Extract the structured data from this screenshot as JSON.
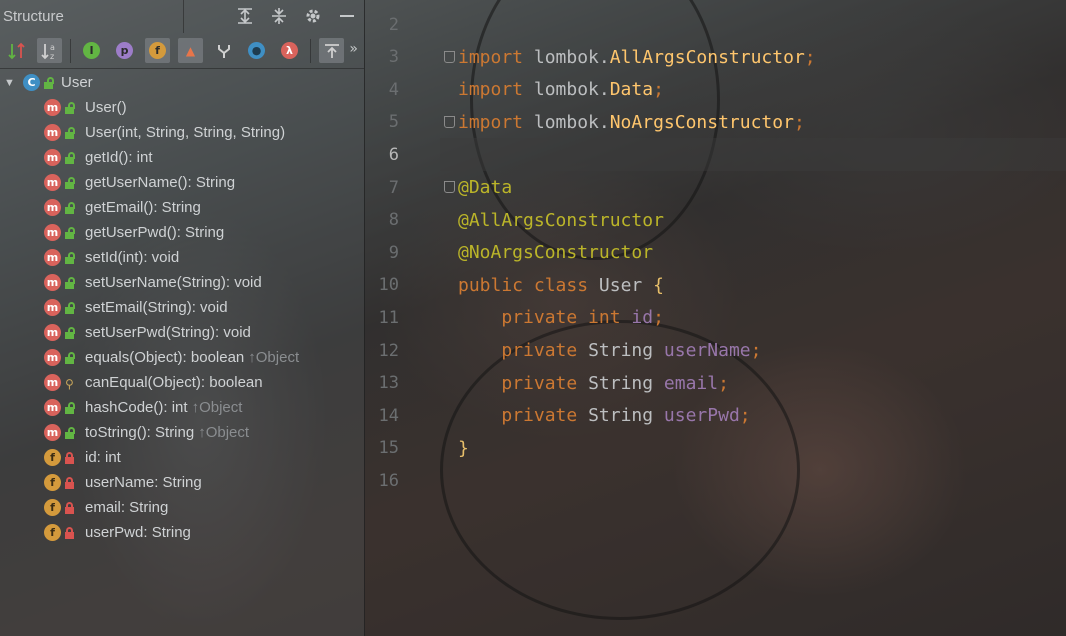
{
  "structure_panel": {
    "title": "Structure",
    "header_tools": [
      "expand-all-icon",
      "collapse-all-icon",
      "gear-icon",
      "minimize-icon"
    ],
    "toolbar": {
      "sort_by_visibility": "sort-visibility-icon",
      "sort_alpha_label": "↓a z",
      "show_inherited": "I",
      "show_properties": "p",
      "show_fields": "f",
      "show_non_public": "▲",
      "show_anonymous": "anonymous-icon",
      "show_lambdas_circle": "●",
      "show_lambdas": "λ",
      "autoscroll": "autoscroll-icon",
      "more": "»"
    },
    "root": {
      "label": "User",
      "icon": "C"
    },
    "members": [
      {
        "kind": "m",
        "visibility": "public",
        "label": "User()",
        "inherited": ""
      },
      {
        "kind": "m",
        "visibility": "public",
        "label": "User(int, String, String, String)",
        "inherited": ""
      },
      {
        "kind": "m",
        "visibility": "public",
        "label": "getId(): int",
        "inherited": ""
      },
      {
        "kind": "m",
        "visibility": "public",
        "label": "getUserName(): String",
        "inherited": ""
      },
      {
        "kind": "m",
        "visibility": "public",
        "label": "getEmail(): String",
        "inherited": ""
      },
      {
        "kind": "m",
        "visibility": "public",
        "label": "getUserPwd(): String",
        "inherited": ""
      },
      {
        "kind": "m",
        "visibility": "public",
        "label": "setId(int): void",
        "inherited": ""
      },
      {
        "kind": "m",
        "visibility": "public",
        "label": "setUserName(String): void",
        "inherited": ""
      },
      {
        "kind": "m",
        "visibility": "public",
        "label": "setEmail(String): void",
        "inherited": ""
      },
      {
        "kind": "m",
        "visibility": "public",
        "label": "setUserPwd(String): void",
        "inherited": ""
      },
      {
        "kind": "m",
        "visibility": "public",
        "label": "equals(Object): boolean",
        "inherited": "↑Object"
      },
      {
        "kind": "m",
        "visibility": "protected",
        "label": "canEqual(Object): boolean",
        "inherited": ""
      },
      {
        "kind": "m",
        "visibility": "public",
        "label": "hashCode(): int",
        "inherited": "↑Object"
      },
      {
        "kind": "m",
        "visibility": "public",
        "label": "toString(): String",
        "inherited": "↑Object"
      },
      {
        "kind": "f",
        "visibility": "private",
        "label": "id: int",
        "inherited": ""
      },
      {
        "kind": "f",
        "visibility": "private",
        "label": "userName: String",
        "inherited": ""
      },
      {
        "kind": "f",
        "visibility": "private",
        "label": "email: String",
        "inherited": ""
      },
      {
        "kind": "f",
        "visibility": "private",
        "label": "userPwd: String",
        "inherited": ""
      }
    ]
  },
  "editor": {
    "current_line": "6",
    "lines": [
      {
        "n": "2",
        "tokens": []
      },
      {
        "n": "3",
        "fold": true,
        "tokens": [
          [
            "kw",
            "import "
          ],
          [
            "ident",
            "lombok."
          ],
          [
            "cls",
            "AllArgsConstructor"
          ],
          [
            "punct",
            ";"
          ]
        ]
      },
      {
        "n": "4",
        "tokens": [
          [
            "kw",
            "import "
          ],
          [
            "ident",
            "lombok."
          ],
          [
            "cls",
            "Data"
          ],
          [
            "punct",
            ";"
          ]
        ]
      },
      {
        "n": "5",
        "fold": true,
        "tokens": [
          [
            "kw",
            "import "
          ],
          [
            "ident",
            "lombok."
          ],
          [
            "cls",
            "NoArgsConstructor"
          ],
          [
            "punct",
            ";"
          ]
        ]
      },
      {
        "n": "6",
        "tokens": []
      },
      {
        "n": "7",
        "fold": true,
        "tokens": [
          [
            "anno",
            "@Data"
          ]
        ]
      },
      {
        "n": "8",
        "tokens": [
          [
            "anno",
            "@AllArgsConstructor"
          ]
        ]
      },
      {
        "n": "9",
        "tokens": [
          [
            "anno",
            "@NoArgsConstructor"
          ]
        ]
      },
      {
        "n": "10",
        "tokens": [
          [
            "kw",
            "public class "
          ],
          [
            "ident",
            "User "
          ],
          [
            "brace",
            "{"
          ]
        ]
      },
      {
        "n": "11",
        "tokens": [
          [
            "ident",
            "    "
          ],
          [
            "kw",
            "private int "
          ],
          [
            "field",
            "id"
          ],
          [
            "punct",
            ";"
          ]
        ]
      },
      {
        "n": "12",
        "tokens": [
          [
            "ident",
            "    "
          ],
          [
            "kw",
            "private "
          ],
          [
            "ident",
            "String "
          ],
          [
            "field",
            "userName"
          ],
          [
            "punct",
            ";"
          ]
        ]
      },
      {
        "n": "13",
        "tokens": [
          [
            "ident",
            "    "
          ],
          [
            "kw",
            "private "
          ],
          [
            "ident",
            "String "
          ],
          [
            "field",
            "email"
          ],
          [
            "punct",
            ";"
          ]
        ]
      },
      {
        "n": "14",
        "tokens": [
          [
            "ident",
            "    "
          ],
          [
            "kw",
            "private "
          ],
          [
            "ident",
            "String "
          ],
          [
            "field",
            "userPwd"
          ],
          [
            "punct",
            ";"
          ]
        ]
      },
      {
        "n": "15",
        "tokens": [
          [
            "brace",
            "}"
          ]
        ]
      },
      {
        "n": "16",
        "tokens": []
      }
    ]
  }
}
